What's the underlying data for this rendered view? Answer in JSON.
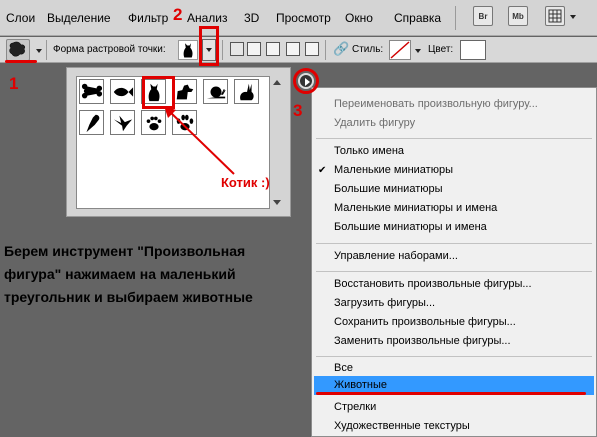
{
  "menubar": {
    "items": [
      "Слои",
      "Выделение",
      "Фильтр",
      "Анализ",
      "3D",
      "Просмотр",
      "Окно",
      "Справка"
    ],
    "br_label": "Br",
    "mb_label": "Mb"
  },
  "options": {
    "shape_label": "Форма растровой точки:",
    "style_label": "Стиль:",
    "color_label": "Цвет:"
  },
  "picker": {
    "row1_icons": [
      "bone-icon",
      "fish-icon",
      "cat-icon",
      "dog-icon",
      "snail-icon",
      "rabbit-icon"
    ],
    "row2_icons": [
      "parrot-icon",
      "dove-icon",
      "cat-paw-icon",
      "dog-paw-icon"
    ]
  },
  "menu": {
    "items": [
      {
        "label": "Переименовать произвольную фигуру...",
        "disabled": true
      },
      {
        "label": "Удалить фигуру",
        "disabled": true
      },
      {
        "label": "Только имена"
      },
      {
        "label": "Маленькие миниатюры",
        "checked": true
      },
      {
        "label": "Большие миниатюры"
      },
      {
        "label": "Маленькие миниатюры и имена"
      },
      {
        "label": "Большие миниатюры и имена"
      },
      {
        "label": "Управление наборами..."
      },
      {
        "label": "Восстановить произвольные фигуры..."
      },
      {
        "label": "Загрузить фигуры..."
      },
      {
        "label": "Сохранить произвольные фигуры..."
      },
      {
        "label": "Заменить произвольные фигуры..."
      },
      {
        "label": "Все"
      },
      {
        "label": "Животные",
        "highlighted": true
      },
      {
        "label": "Стрелки"
      },
      {
        "label": "Художественные текстуры"
      }
    ],
    "checkmark": "✔"
  },
  "annotations": {
    "step1": "1",
    "step2": "2",
    "step3": "3",
    "kotik": "Котик :)",
    "caption": "Берем инструмент \"Произвольная фигура\" нажимаем на маленький треугольник и выбираем животные"
  },
  "colors": {
    "highlight": "#3399ff",
    "annotation_red": "#e00000",
    "menu_bg": "#f0f0f0",
    "canvas_bg": "#646464"
  }
}
